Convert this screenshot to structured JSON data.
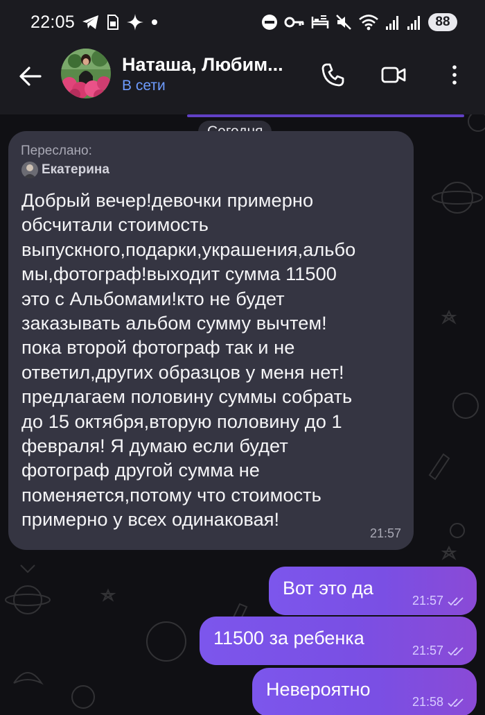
{
  "status_bar": {
    "time": "22:05",
    "battery": "88",
    "left_icons": [
      "telegram-icon",
      "sim-card-icon",
      "sparkle-icon",
      "dot-icon"
    ],
    "right_icons": [
      "do-not-disturb-icon",
      "vpn-key-icon",
      "bed-icon",
      "mute-icon",
      "wifi-icon",
      "signal-icon",
      "signal-icon"
    ]
  },
  "header": {
    "contact_name": "Наташа, Любим...",
    "contact_status": "В сети",
    "status_color": "#6e9cff",
    "icons": [
      "back-arrow-icon",
      "phone-icon",
      "video-camera-icon",
      "more-vertical-icon"
    ]
  },
  "chat": {
    "date_separator": "Сегодня",
    "accent_color": "#7c56ec",
    "messages": [
      {
        "direction": "incoming",
        "forwarded_label": "Переслано:",
        "forwarded_from": "Екатерина",
        "text": "Добрый вечер!девочки примерно\nобсчитали стоимость\nвыпускного,подарки,украшения,альбо\nмы,фотограф!выходит сумма 11500\nэто с Альбомами!кто не будет\nзаказывать альбом сумму вычтем!\nпока второй фотограф так и не\nответил,других образцов у меня нет!\nпредлагаем половину суммы собрать\nдо 15 октября,вторую половину до 1\nфевраля! Я думаю если будет\nфотограф другой сумма не\nпоменяется,потому что стоимость\nпримерно у всех одинаковая!",
        "time": "21:57"
      },
      {
        "direction": "outgoing",
        "text": "Вот это да",
        "time": "21:57",
        "read_icon": "double-check-icon"
      },
      {
        "direction": "outgoing",
        "text": "11500 за ребенка",
        "time": "21:57",
        "read_icon": "double-check-icon"
      },
      {
        "direction": "outgoing",
        "text": "Невероятно",
        "time": "21:58",
        "read_icon": "double-check-icon"
      }
    ]
  }
}
